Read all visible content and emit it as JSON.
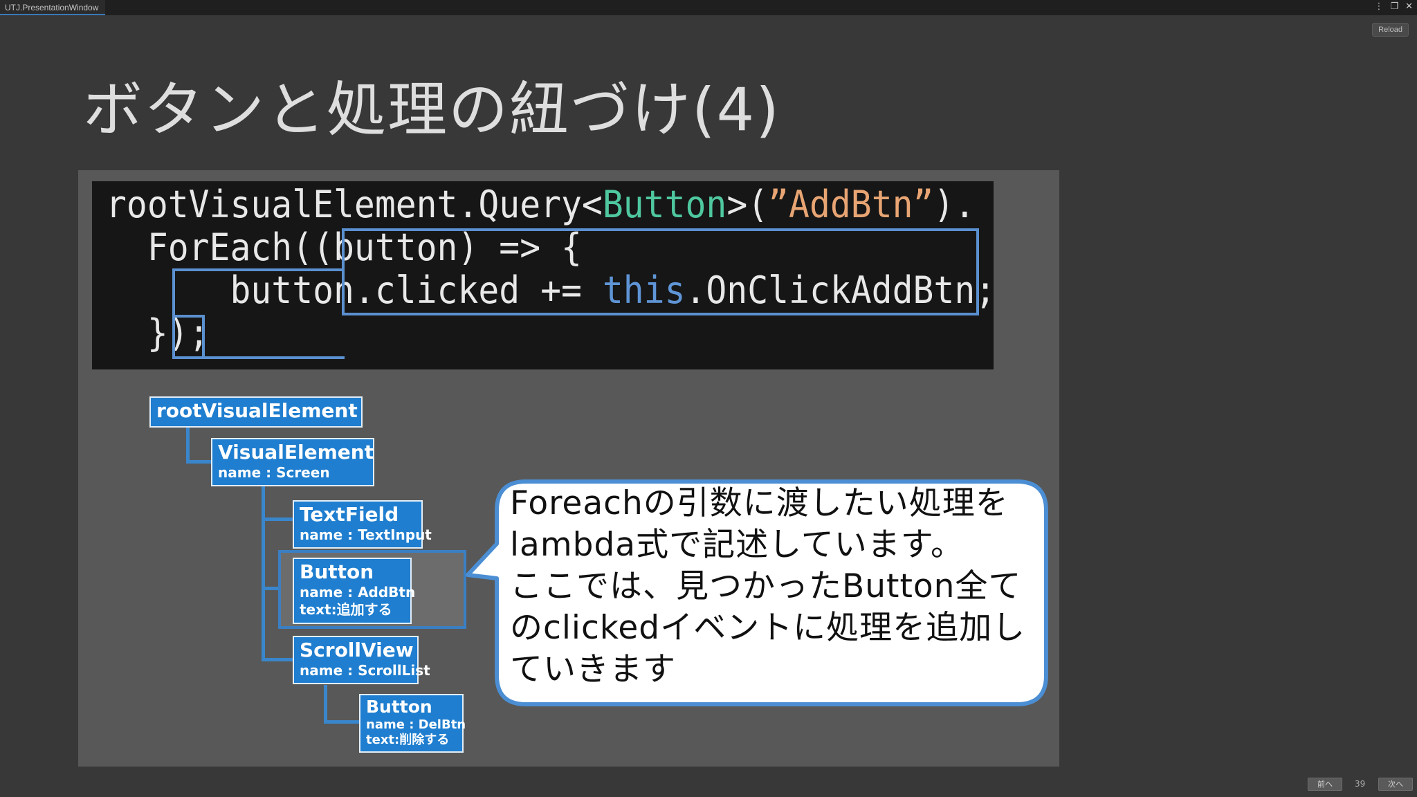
{
  "window": {
    "tab_title": "UTJ.PresentationWindow",
    "reload_label": "Reload"
  },
  "slide": {
    "title": "ボタンと処理の紐づけ(4)"
  },
  "code": {
    "l1_a": "rootVisualElement.Query<",
    "l1_type": "Button",
    "l1_b": ">(",
    "l1_str": "”AddBtn”",
    "l1_c": ").",
    "l2": "  ForEach((button) => {",
    "l3_a": "      button.clicked += ",
    "l3_kw": "this",
    "l3_b": ".OnClickAddBtn;",
    "l4": "  });"
  },
  "tree": {
    "root": {
      "title": "rootVisualElement"
    },
    "visual": {
      "title": "VisualElement",
      "sub1": "name : Screen"
    },
    "textfield": {
      "title": "TextField",
      "sub1": "name : TextInput"
    },
    "button_add": {
      "title": "Button",
      "sub1": "name : AddBtn",
      "sub2": "text:追加する"
    },
    "scrollview": {
      "title": "ScrollView",
      "sub1": "name : ScrollList"
    },
    "button_del": {
      "title": "Button",
      "sub1": "name : DelBtn",
      "sub2": "text:削除する"
    }
  },
  "callout": {
    "lines": [
      "Foreachの引数に渡したい処理を",
      "lambda式で記述しています。",
      "ここでは、見つかったButton全て",
      "のclickedイベントに処理を追加し",
      "ていきます"
    ]
  },
  "nav": {
    "prev_label": "前へ",
    "page": "39",
    "next_label": "次へ"
  },
  "colors": {
    "node_fill": "#1f7ecf",
    "highlight": "#5b90d0",
    "type": "#4fc8a0",
    "string": "#e8a573",
    "keyword": "#5f95d6"
  }
}
